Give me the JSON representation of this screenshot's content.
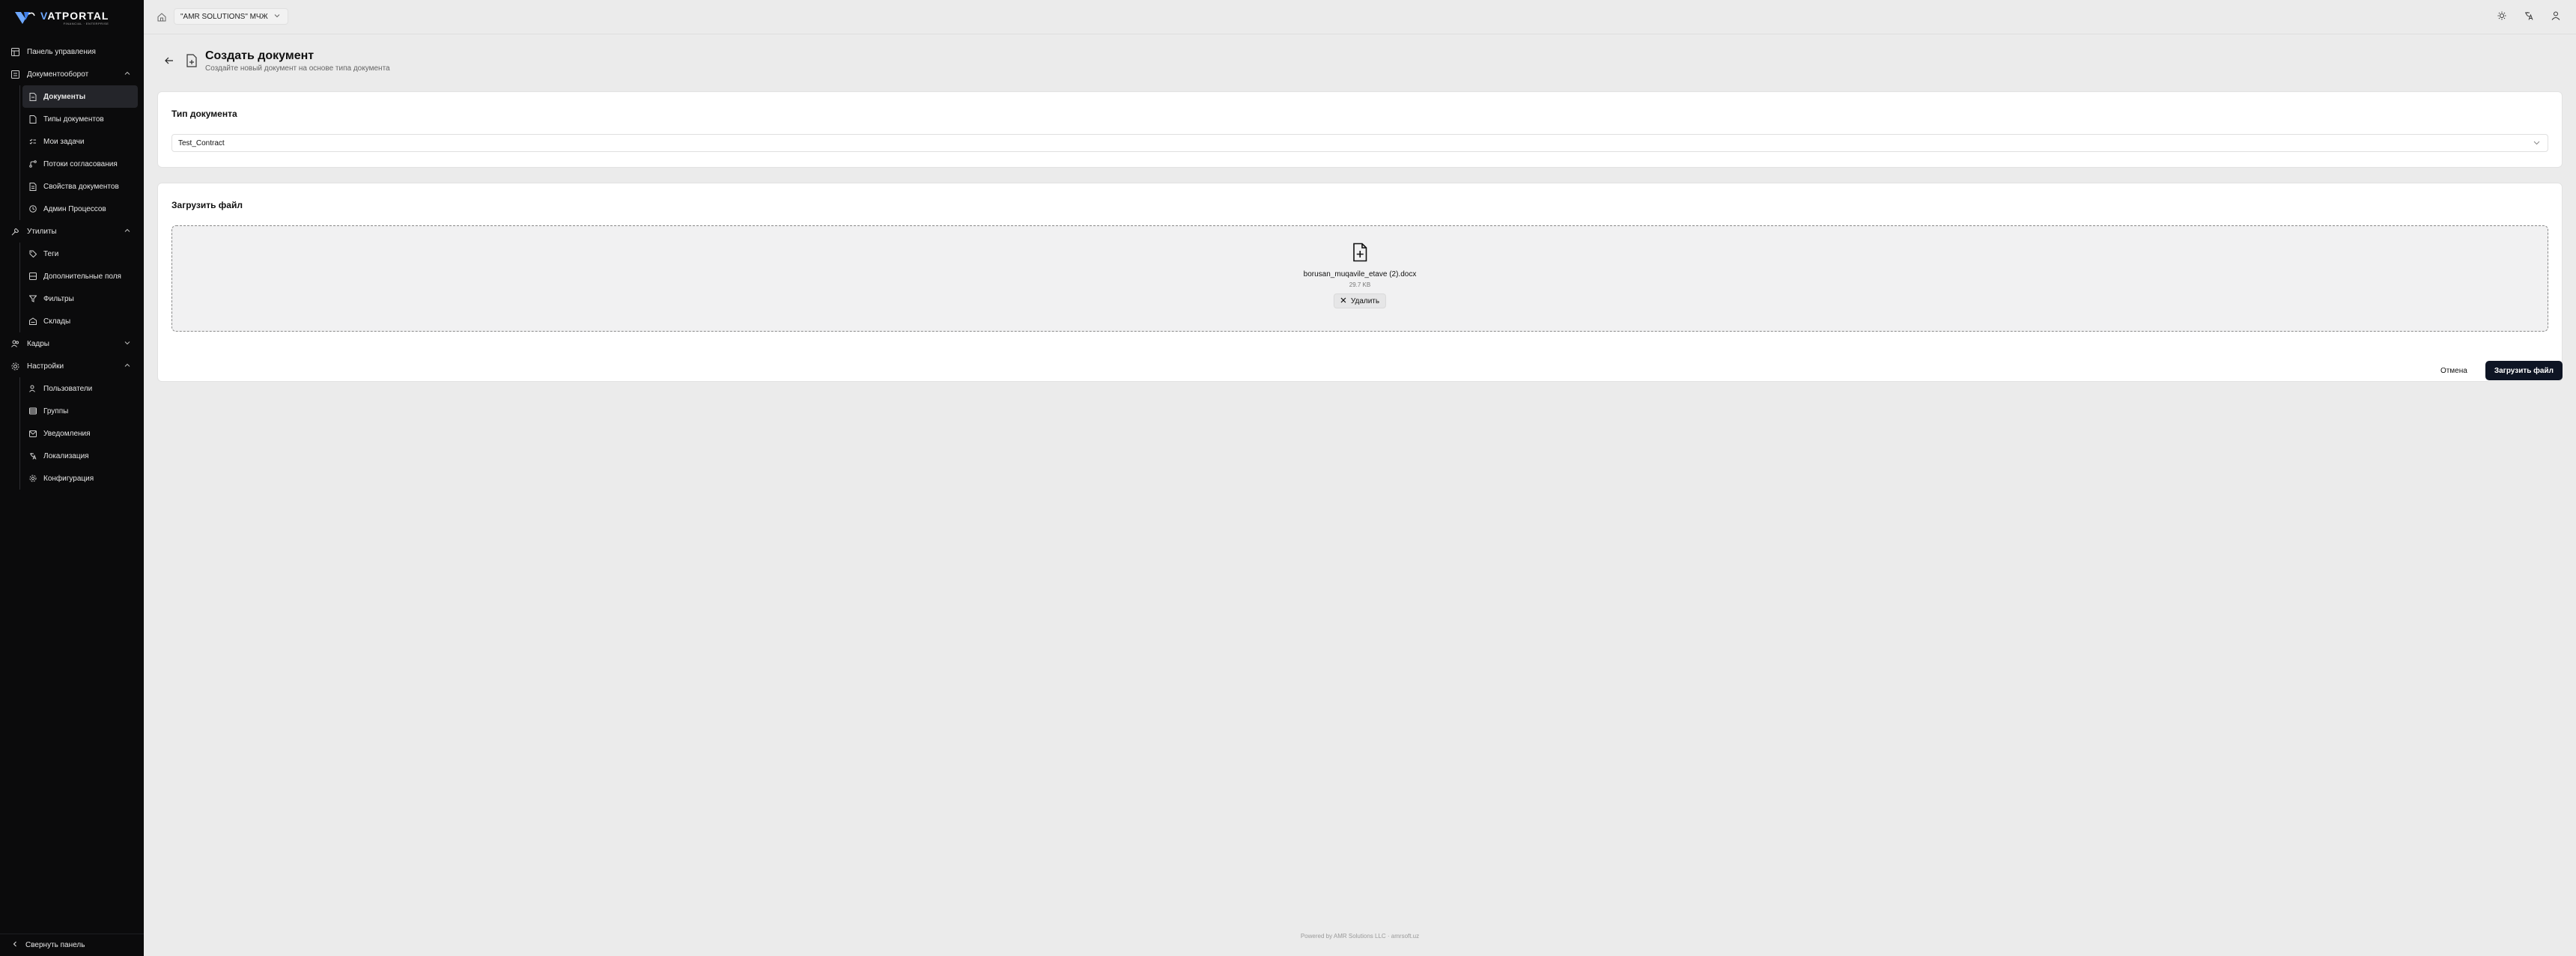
{
  "brand": {
    "name_prefix": "V",
    "name": "ATPORTAL",
    "tagline": "FINANCIAL · ENTERPRISE"
  },
  "sidebar": {
    "items": [
      {
        "label": "Панель управления",
        "icon": "dashboard-icon"
      },
      {
        "label": "Документооборот",
        "icon": "document-flow-icon",
        "expanded": true,
        "children": [
          {
            "label": "Документы",
            "icon": "document-icon",
            "active": true
          },
          {
            "label": "Типы документов",
            "icon": "document-types-icon"
          },
          {
            "label": "Мои задачи",
            "icon": "tasks-icon"
          },
          {
            "label": "Потоки согласования",
            "icon": "workflow-icon"
          },
          {
            "label": "Свойства документов",
            "icon": "properties-icon"
          },
          {
            "label": "Админ Процессов",
            "icon": "process-admin-icon"
          }
        ]
      },
      {
        "label": "Утилиты",
        "icon": "wrench-icon",
        "expanded": true,
        "children": [
          {
            "label": "Теги",
            "icon": "tag-icon"
          },
          {
            "label": "Дополнительные поля",
            "icon": "fields-icon"
          },
          {
            "label": "Фильтры",
            "icon": "filter-icon"
          },
          {
            "label": "Склады",
            "icon": "warehouse-icon"
          }
        ]
      },
      {
        "label": "Кадры",
        "icon": "people-icon",
        "expanded": false
      },
      {
        "label": "Настройки",
        "icon": "settings-icon",
        "expanded": true,
        "children": [
          {
            "label": "Пользователи",
            "icon": "users-icon"
          },
          {
            "label": "Группы",
            "icon": "groups-icon"
          },
          {
            "label": "Уведомления",
            "icon": "mail-icon"
          },
          {
            "label": "Локализация",
            "icon": "translate-icon"
          },
          {
            "label": "Конфигурация",
            "icon": "gear-icon"
          }
        ]
      }
    ],
    "collapse_label": "Свернуть панель"
  },
  "topbar": {
    "company": "\"AMR SOLUTIONS\" МЧЖ"
  },
  "page": {
    "title": "Создать документ",
    "subtitle": "Создайте новый документ на основе типа документа"
  },
  "doc_type": {
    "heading": "Тип документа",
    "selected": "Test_Contract"
  },
  "upload": {
    "heading": "Загрузить файл",
    "file_name": "borusan_muqavile_etave (2).docx",
    "file_size": "29.7 KB",
    "remove_label": "Удалить"
  },
  "actions": {
    "cancel": "Отмена",
    "submit": "Загрузить файл"
  },
  "footer": "Powered by AMR Solutions LLC · amrsoft.uz",
  "colors": {
    "sidebar_bg": "#0b0b0c",
    "primary": "#0e1524",
    "page_bg": "#ebebeb"
  }
}
